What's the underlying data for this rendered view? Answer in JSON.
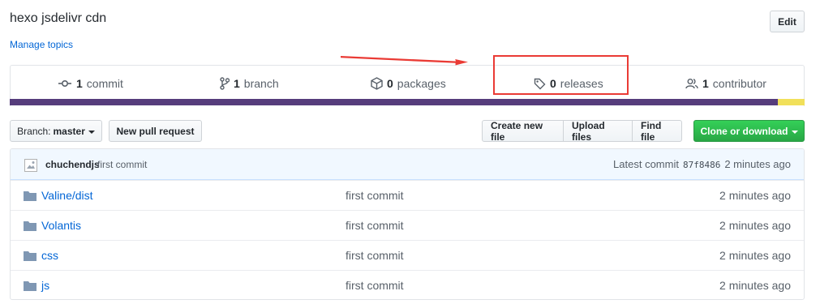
{
  "repo": {
    "description": "hexo jsdelivr cdn",
    "manage_topics": "Manage topics",
    "edit_label": "Edit"
  },
  "summary": {
    "commits": {
      "count": "1",
      "label": "commit",
      "icon": "history-icon"
    },
    "branches": {
      "count": "1",
      "label": "branch",
      "icon": "branch-icon"
    },
    "packages": {
      "count": "0",
      "label": "packages",
      "icon": "package-icon"
    },
    "releases": {
      "count": "0",
      "label": "releases",
      "icon": "tag-icon"
    },
    "contributors": {
      "count": "1",
      "label": "contributor",
      "icon": "people-icon"
    }
  },
  "languages": [
    {
      "color": "#563d7c",
      "fraction": 0.966
    },
    {
      "color": "#f1e05a",
      "fraction": 0.034
    }
  ],
  "annotation": {
    "box_color": "#ea3b35",
    "arrow_color": "#ea3b35"
  },
  "toolbar": {
    "branch_prefix": "Branch:",
    "branch_name": "master",
    "new_pull_request": "New pull request",
    "create_new_file": "Create new file",
    "upload_files": "Upload files",
    "find_file": "Find file",
    "clone_or_download": "Clone or download"
  },
  "commit": {
    "author": "chuchendjs",
    "message": "first commit",
    "latest_label": "Latest commit",
    "sha": "87f8486",
    "age": "2 minutes ago"
  },
  "files": [
    {
      "name": "Valine/dist",
      "message": "first commit",
      "age": "2 minutes ago"
    },
    {
      "name": "Volantis",
      "message": "first commit",
      "age": "2 minutes ago"
    },
    {
      "name": "css",
      "message": "first commit",
      "age": "2 minutes ago"
    },
    {
      "name": "js",
      "message": "first commit",
      "age": "2 minutes ago"
    }
  ],
  "colors": {
    "link": "#0366d6",
    "primary_button": "#28a745"
  }
}
